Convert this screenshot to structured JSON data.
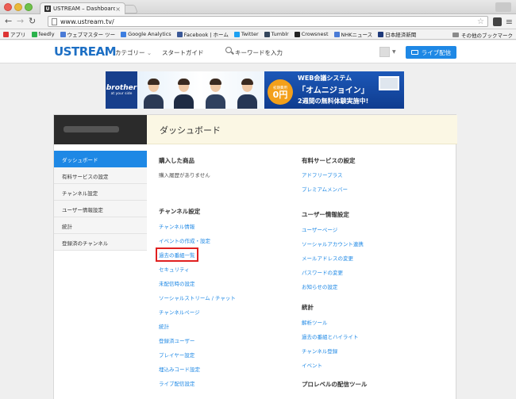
{
  "browser": {
    "tab_title": "USTREAM – Dashboard",
    "url": "www.ustream.tv/",
    "bookmarks": [
      {
        "label": "アプリ",
        "icon": "apps-icon",
        "color": "#d33"
      },
      {
        "label": "feedly",
        "icon": "feedly-icon",
        "color": "#2bb24c"
      },
      {
        "label": "ウェブマスター ツー",
        "icon": "webmaster-icon",
        "color": "#4a7bd6"
      },
      {
        "label": "Google Analytics",
        "icon": "analytics-icon",
        "color": "#3d7ee0"
      },
      {
        "label": "Facebook | ホーム",
        "icon": "facebook-icon",
        "color": "#3b5998"
      },
      {
        "label": "Twitter",
        "icon": "twitter-icon",
        "color": "#1da1f2"
      },
      {
        "label": "Tumblr",
        "icon": "tumblr-icon",
        "color": "#35465c"
      },
      {
        "label": "Crowsnest",
        "icon": "crowsnest-icon",
        "color": "#222"
      },
      {
        "label": "NHKニュース",
        "icon": "nhk-icon",
        "color": "#4a7bd6"
      },
      {
        "label": "日本経済新聞",
        "icon": "nikkei-icon",
        "color": "#1f3a7a"
      }
    ],
    "other_bookmarks": "その他のブックマーク"
  },
  "header": {
    "logo": "USTREAM",
    "category": "カテゴリー",
    "start_guide": "スタートガイド",
    "search_placeholder": "キーワードを入力",
    "live_button": "ライブ配信"
  },
  "banner": {
    "brand": "brother",
    "brand_tag": "at your side",
    "title": "WEB会議システム",
    "product": "「オムニジョイン」",
    "badge_small": "初期費用",
    "badge_big": "0円",
    "trial": "2週間の無料体験実施中!"
  },
  "page": {
    "title": "ダッシュボード"
  },
  "sidebar": {
    "items": [
      {
        "label": "ダッシュボード",
        "active": true
      },
      {
        "label": "有料サービスの設定",
        "active": false
      },
      {
        "label": "チャンネル設定",
        "active": false
      },
      {
        "label": "ユーザー情報設定",
        "active": false
      },
      {
        "label": "統計",
        "active": false
      },
      {
        "label": "登録済のチャンネル",
        "active": false
      }
    ]
  },
  "left_col": {
    "purchased": {
      "heading": "購入した商品",
      "empty": "購入履歴がありません"
    },
    "channel": {
      "heading": "チャンネル設定",
      "links": [
        "チャンネル情報",
        "イベントの作成・設定",
        "過去の番組一覧",
        "セキュリティ",
        "未配信時の設定",
        "ソーシャルストリーム / チャット",
        "チャンネルページ",
        "統計",
        "登録済ユーザー",
        "プレイヤー設定",
        "埋込みコード設定",
        "ライブ配信設定"
      ]
    }
  },
  "right_col": {
    "paid": {
      "heading": "有料サービスの設定",
      "links": [
        "アドフリープラス",
        "プレミアムメンバー"
      ]
    },
    "user": {
      "heading": "ユーザー情報設定",
      "links": [
        "ユーザーページ",
        "ソーシャルアカウント連携",
        "メールアドレスの変更",
        "パスワードの変更",
        "お知らせの設定"
      ]
    },
    "stats": {
      "heading": "統計",
      "links": [
        "解析ツール",
        "過去の番組とハイライト",
        "チャンネル登録",
        "イベント"
      ]
    },
    "pro": {
      "heading": "プロレベルの配信ツール"
    }
  }
}
